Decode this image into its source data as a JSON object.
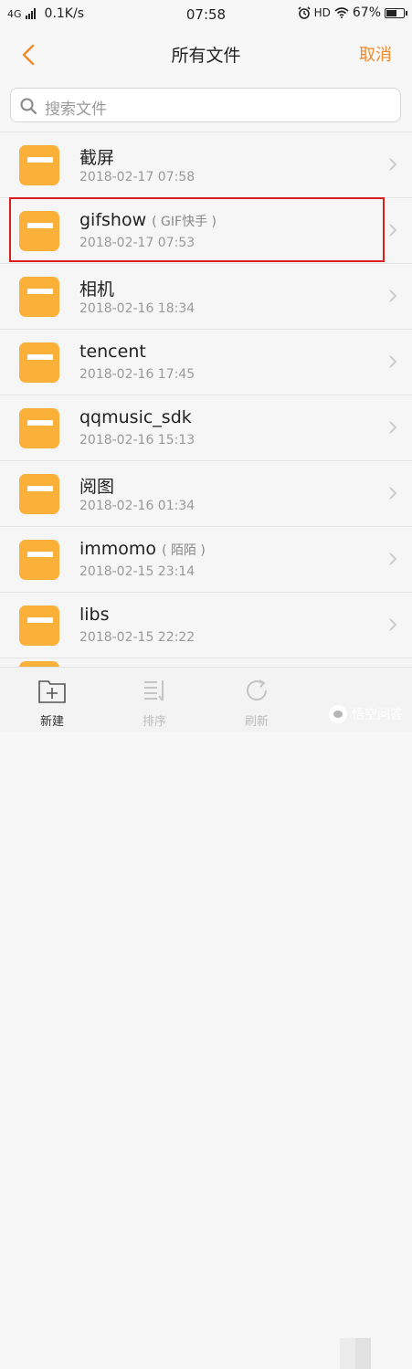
{
  "status_bar": {
    "network": "4G",
    "speed": "0.1K/s",
    "time": "07:58",
    "hd": "HD",
    "battery": "67%",
    "battery_level": 0.67
  },
  "header": {
    "title": "所有文件",
    "cancel_label": "取消"
  },
  "search": {
    "placeholder": "搜索文件"
  },
  "files": [
    {
      "name": "截屏",
      "subtitle": "",
      "date": "2018-02-17 07:58"
    },
    {
      "name": "gifshow",
      "subtitle": "( GIF快手 )",
      "date": "2018-02-17 07:53"
    },
    {
      "name": "相机",
      "subtitle": "",
      "date": "2018-02-16 18:34"
    },
    {
      "name": "tencent",
      "subtitle": "",
      "date": "2018-02-16 17:45"
    },
    {
      "name": "qqmusic_sdk",
      "subtitle": "",
      "date": "2018-02-16 15:13"
    },
    {
      "name": "阅图",
      "subtitle": "",
      "date": "2018-02-16 01:34"
    },
    {
      "name": "immomo",
      "subtitle": "( 陌陌 )",
      "date": "2018-02-15 23:14"
    },
    {
      "name": "libs",
      "subtitle": "",
      "date": "2018-02-15 22:22"
    }
  ],
  "toolbar": {
    "new_label": "新建",
    "sort_label": "排序",
    "refresh_label": "刷新"
  },
  "watermark": "悟空问答",
  "colors": {
    "accent": "#f08a2b",
    "folder": "#fbb03a",
    "highlight": "#d9201f"
  }
}
